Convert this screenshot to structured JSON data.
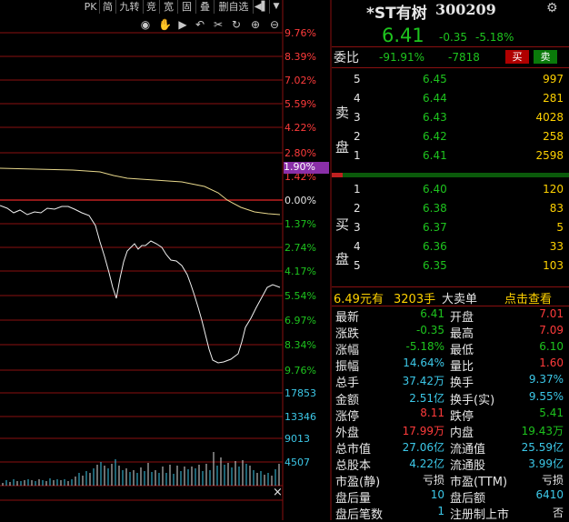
{
  "toolbar": {
    "tabs": [
      "PK",
      "简",
      "九转",
      "竞",
      "宽",
      "固",
      "叠",
      "删自选"
    ],
    "icons": [
      "eye-icon",
      "hand-icon",
      "play-icon",
      "undo-icon",
      "cut-icon",
      "refresh-icon",
      "zoom-in-icon",
      "zoom-out-icon"
    ]
  },
  "chart": {
    "price_axis": [
      "9.76%",
      "8.39%",
      "7.02%",
      "5.59%",
      "4.22%",
      "2.80%",
      "1.42%",
      "0.00%",
      "1.37%",
      "2.74%",
      "4.17%",
      "5.54%",
      "6.97%",
      "8.34%",
      "9.76%"
    ],
    "current_pct_badge": "1.90%",
    "volume_axis": [
      "17853",
      "13346",
      "9013",
      "4507"
    ],
    "close_marker": "×"
  },
  "header": {
    "name": "*ST有树",
    "code": "300209",
    "price": "6.41",
    "change": "-0.35",
    "change_pct": "-5.18%"
  },
  "weibi": {
    "label": "委比",
    "ratio": "-91.91%",
    "diff": "-7818",
    "sell_btn": "买",
    "buy_btn": "卖"
  },
  "sell_side_label": [
    "卖",
    "盘"
  ],
  "buy_side_label": [
    "买",
    "盘"
  ],
  "sell_orders": [
    {
      "level": "5",
      "price": "6.45",
      "vol": "997"
    },
    {
      "level": "4",
      "price": "6.44",
      "vol": "281"
    },
    {
      "level": "3",
      "price": "6.43",
      "vol": "4028"
    },
    {
      "level": "2",
      "price": "6.42",
      "vol": "258"
    },
    {
      "level": "1",
      "price": "6.41",
      "vol": "2598"
    }
  ],
  "buy_orders": [
    {
      "level": "1",
      "price": "6.40",
      "vol": "120"
    },
    {
      "level": "2",
      "price": "6.38",
      "vol": "83"
    },
    {
      "level": "3",
      "price": "6.37",
      "vol": "5"
    },
    {
      "level": "4",
      "price": "6.36",
      "vol": "33"
    },
    {
      "level": "5",
      "price": "6.35",
      "vol": "103"
    }
  ],
  "bigorder": {
    "price": "6.49元有",
    "qty": "3203手",
    "label": "大卖单",
    "link": "点击查看"
  },
  "stats": [
    {
      "l1": "最新",
      "v1": "6.41",
      "c1": "green",
      "l2": "开盘",
      "v2": "7.01",
      "c2": "red"
    },
    {
      "l1": "涨跌",
      "v1": "-0.35",
      "c1": "green",
      "l2": "最高",
      "v2": "7.09",
      "c2": "red"
    },
    {
      "l1": "涨幅",
      "v1": "-5.18%",
      "c1": "green",
      "l2": "最低",
      "v2": "6.10",
      "c2": "green"
    },
    {
      "l1": "振幅",
      "v1": "14.64%",
      "c1": "cyan",
      "l2": "量比",
      "v2": "1.60",
      "c2": "red"
    },
    {
      "l1": "总手",
      "v1": "37.42万",
      "c1": "cyan",
      "l2": "换手",
      "v2": "9.37%",
      "c2": "cyan"
    },
    {
      "l1": "金额",
      "v1": "2.51亿",
      "c1": "cyan",
      "l2": "换手(实)",
      "v2": "9.55%",
      "c2": "cyan"
    },
    {
      "l1": "涨停",
      "v1": "8.11",
      "c1": "red",
      "l2": "跌停",
      "v2": "5.41",
      "c2": "green"
    },
    {
      "l1": "外盘",
      "v1": "17.99万",
      "c1": "red",
      "l2": "内盘",
      "v2": "19.43万",
      "c2": "green"
    },
    {
      "l1": "总市值",
      "v1": "27.06亿",
      "c1": "cyan",
      "l2": "流通值",
      "v2": "25.59亿",
      "c2": "cyan"
    },
    {
      "l1": "总股本",
      "v1": "4.22亿",
      "c1": "cyan",
      "l2": "流通股",
      "v2": "3.99亿",
      "c2": "cyan"
    },
    {
      "l1": "市盈(静)",
      "v1": "亏损",
      "c1": "white",
      "l2": "市盈(TTM)",
      "v2": "亏损",
      "c2": "white"
    },
    {
      "l1": "盘后量",
      "v1": "10",
      "c1": "cyan",
      "l2": "盘后额",
      "v2": "6410",
      "c2": "cyan"
    },
    {
      "l1": "盘后笔数",
      "v1": "1",
      "c1": "cyan",
      "l2": "注册制上市",
      "v2": "否",
      "c2": "white"
    }
  ],
  "colors": {
    "up": "#ff3b3b",
    "down": "#1ec41e",
    "grid": "#8a1010",
    "accent": "#ffd200",
    "vol": "#3cc8e8"
  }
}
